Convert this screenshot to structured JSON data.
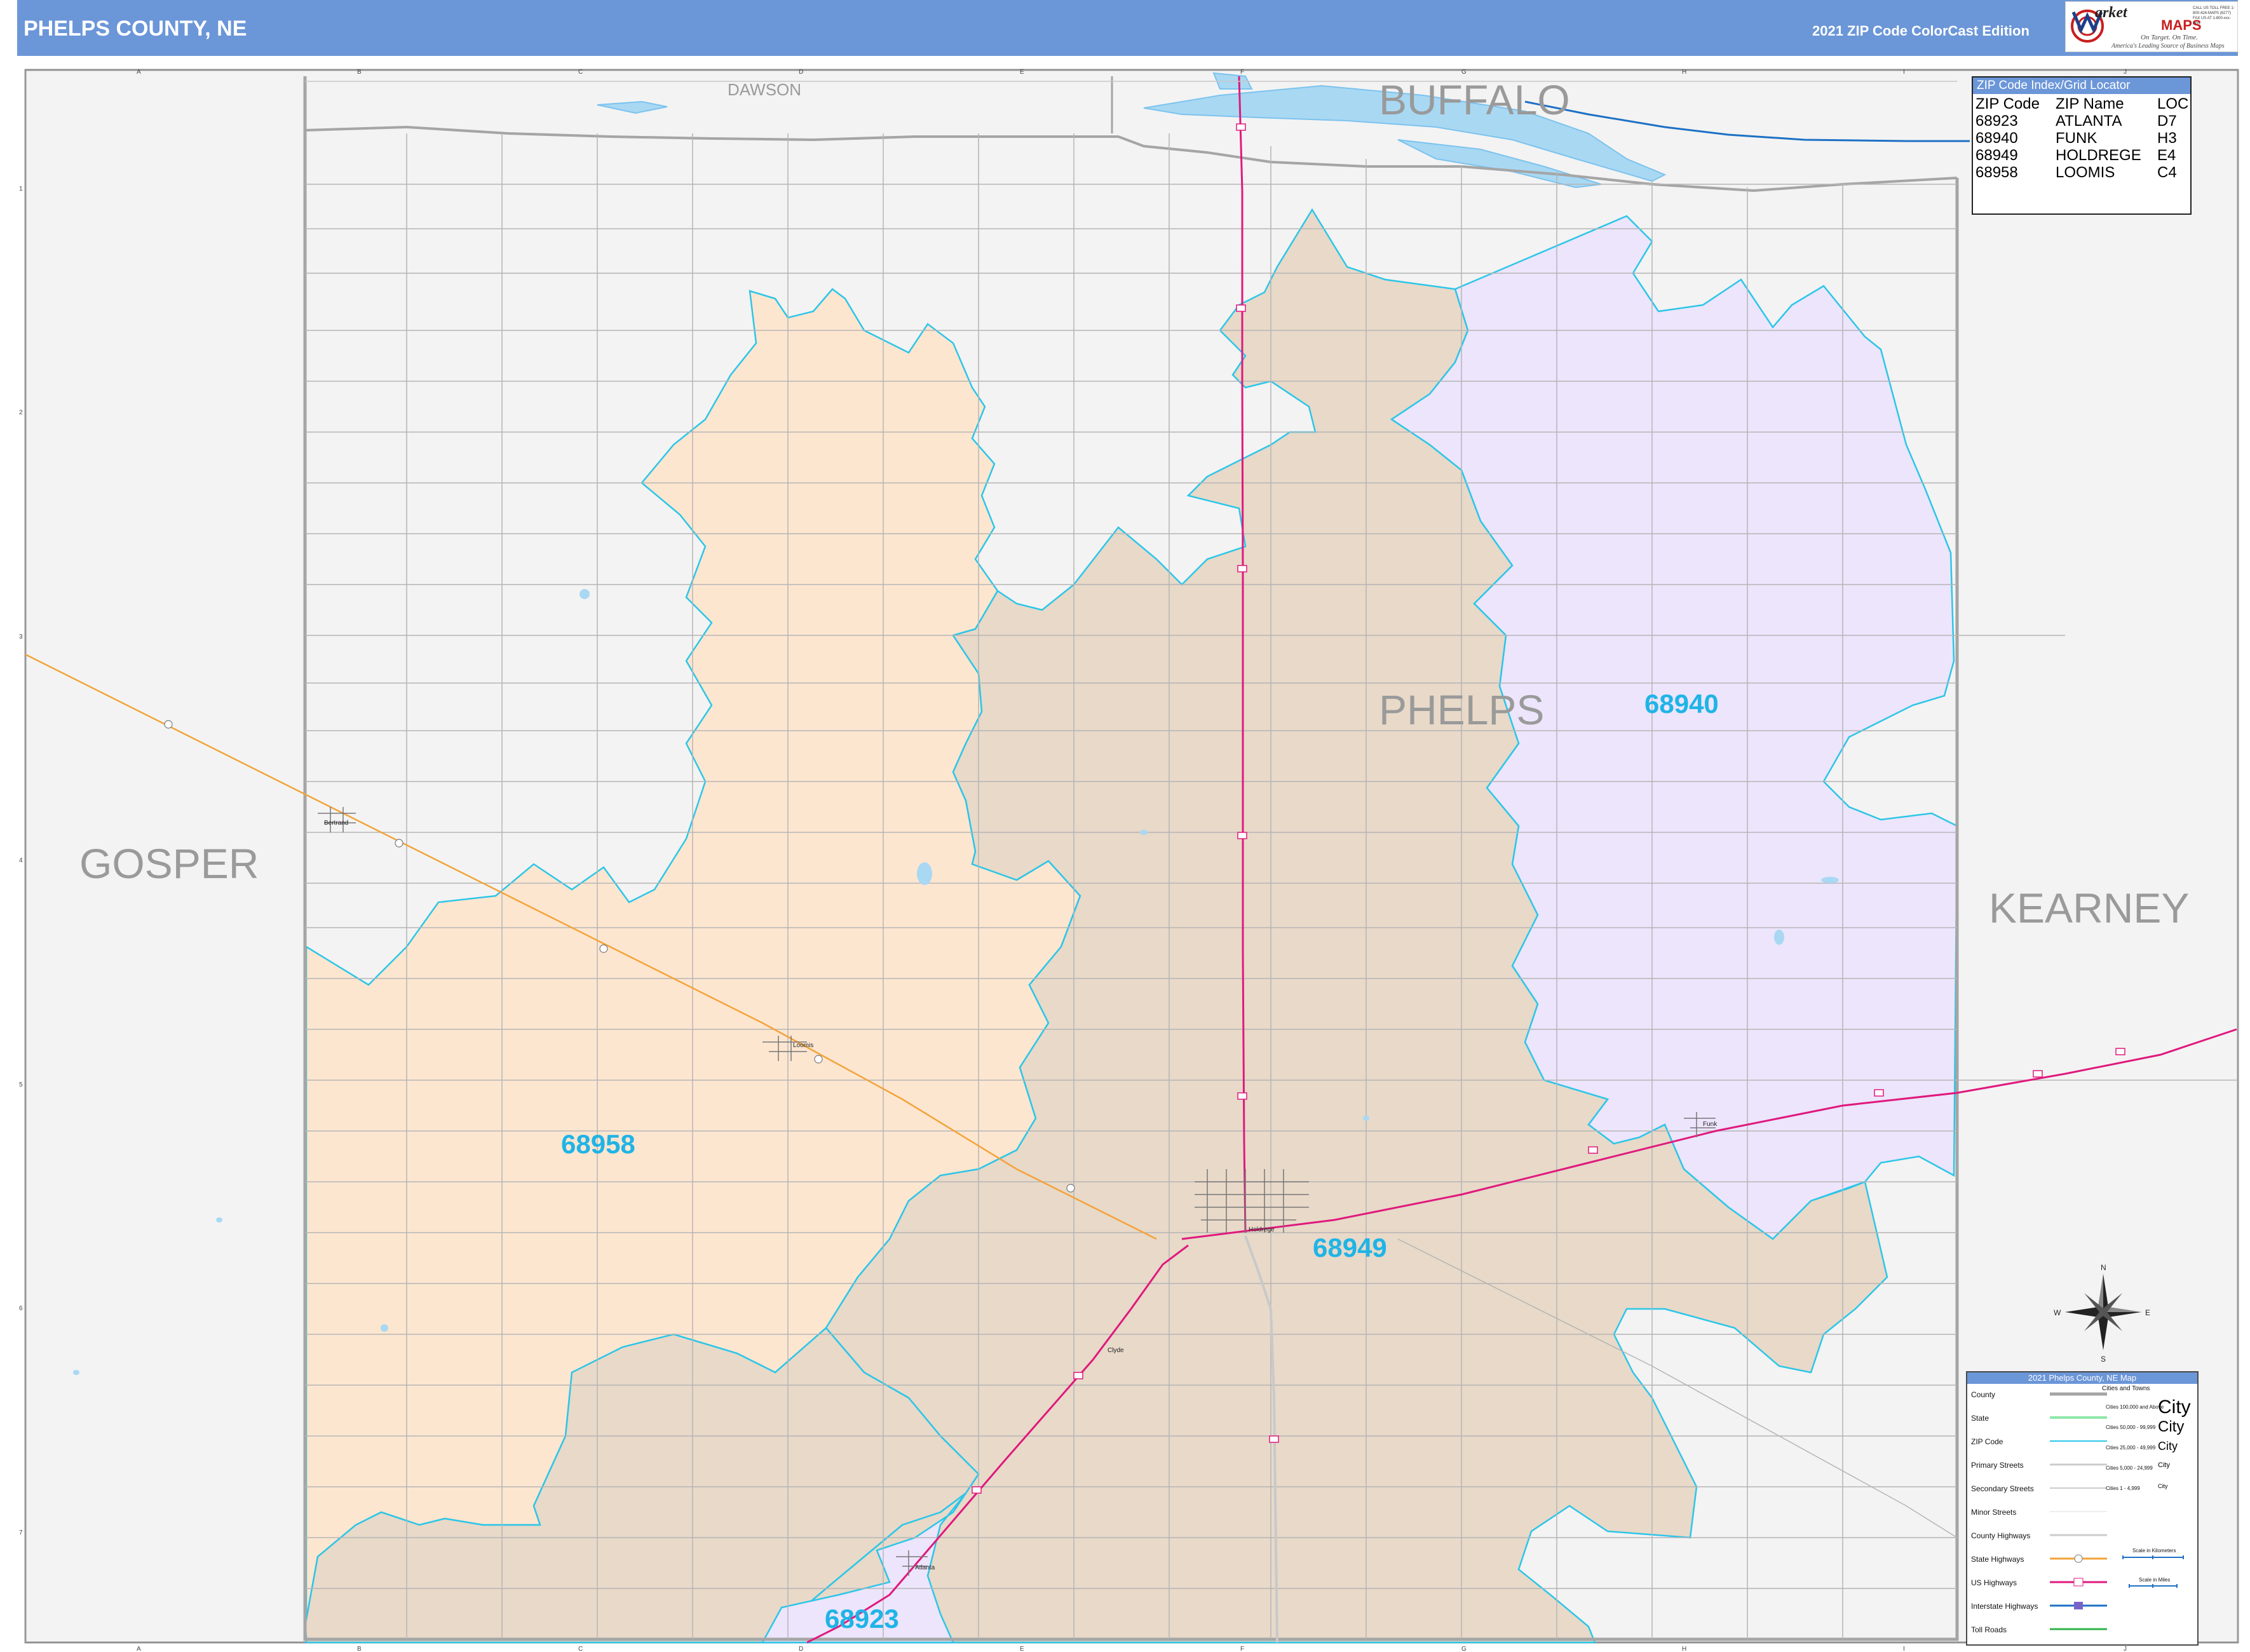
{
  "header": {
    "title": "PHELPS COUNTY, NE",
    "edition": "2021 ZIP Code ColorCast Edition",
    "bg_color": "#6b96d8"
  },
  "logo": {
    "brand_line1": "arket",
    "brand_line2": "MAPS",
    "tagline": "On Target. On Time.",
    "tagline2": "America's Leading Source of Business Maps",
    "contact": "CALL US TOLL FREE 1-800-424-MAPS (6277) FAX US AT 1-800-xxx-xxxx"
  },
  "grid": {
    "letters": [
      "A",
      "B",
      "C",
      "D",
      "E",
      "F",
      "G",
      "H",
      "I",
      "J"
    ],
    "numbers": [
      "1",
      "2",
      "3",
      "4",
      "5",
      "6",
      "7"
    ]
  },
  "counties": {
    "dawson": "DAWSON",
    "buffalo": "BUFFALO",
    "gosper": "GOSPER",
    "phelps": "PHELPS",
    "kearney": "KEARNEY"
  },
  "zips": {
    "z68958": {
      "code": "68958",
      "color": "#fde6d0"
    },
    "z68949": {
      "code": "68949",
      "color": "#e8d9c9"
    },
    "z68940": {
      "code": "68940",
      "color": "#ece5fc"
    },
    "z68923": {
      "code": "68923",
      "color": "#ece5fc"
    }
  },
  "towns": {
    "bertrand": "Bertrand",
    "loomis": "Loomis",
    "holdrege": "Holdrege",
    "funk": "Funk",
    "atlanta": "Atlanta",
    "clyde": "Clyde"
  },
  "compass": {
    "n": "N",
    "s": "S",
    "e": "E",
    "w": "W"
  },
  "zip_index": {
    "title": "ZIP Code Index/Grid Locator",
    "headers": [
      "ZIP Code",
      "ZIP Name",
      "LOC"
    ],
    "rows": [
      [
        "68923",
        "ATLANTA",
        "D7"
      ],
      [
        "68940",
        "FUNK",
        "H3"
      ],
      [
        "68949",
        "HOLDREGE",
        "E4"
      ],
      [
        "68958",
        "LOOMIS",
        "C4"
      ]
    ]
  },
  "legend": {
    "title": "2021 Phelps County, NE Map",
    "cities_header": "Cities and Towns",
    "items": [
      "County",
      "State",
      "ZIP Code",
      "Primary Streets",
      "Secondary Streets",
      "Minor Streets",
      "County Highways",
      "State Highways",
      "US Highways",
      "Interstate Highways",
      "Toll Roads"
    ],
    "city_sizes": [
      "Cities 100,000 and Above",
      "Cities 50,000 - 99,999",
      "Cities 25,000 - 49,999",
      "Cities 5,000 - 24,999",
      "Cities 1 - 4,999"
    ],
    "city_word": "City",
    "scale_km": "Scale in Kilometers",
    "scale_mi": "Scale in Miles"
  }
}
